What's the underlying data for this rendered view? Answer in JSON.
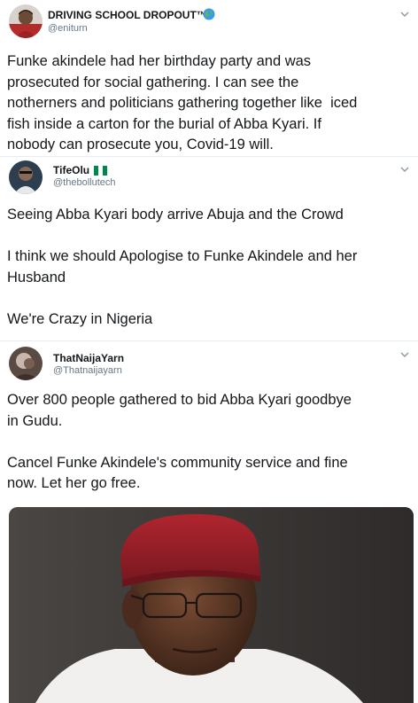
{
  "tweets": [
    {
      "name": "DRIVING SCHOOL DROPOUT™",
      "handle": "@eniturn",
      "text": "Funke akindele had her birthday party and was\nprosecuted for social gathering. I can see the\nnotherners and politicians gathering together like  iced\nfish inside a carton for the burial of Abba Kyari. If\nnobody can prosecute you, Covid-19 will."
    },
    {
      "name": "TifeOlu",
      "handle": "@thebollutech",
      "text": "Seeing Abba Kyari body arrive Abuja and the Crowd\n\nI think we should Apologise to Funke Akindele and her\nHusband\n\nWe're Crazy in Nigeria"
    },
    {
      "name": "ThatNaijaYarn",
      "handle": "@Thatnaijayarn",
      "text": "Over 800 people gathered to bid Abba Kyari goodbye\nin Gudu.\n\nCancel Funke Akindele's community service and fine\nnow. Let her go free."
    }
  ],
  "icons": {
    "globe": "globe-icon",
    "flag": "nigeria-flag-icon",
    "chevron": "chevron-down-icon"
  },
  "colors": {
    "handle": "#657786",
    "divider": "#e6ecf0",
    "flag_green": "#008751"
  }
}
